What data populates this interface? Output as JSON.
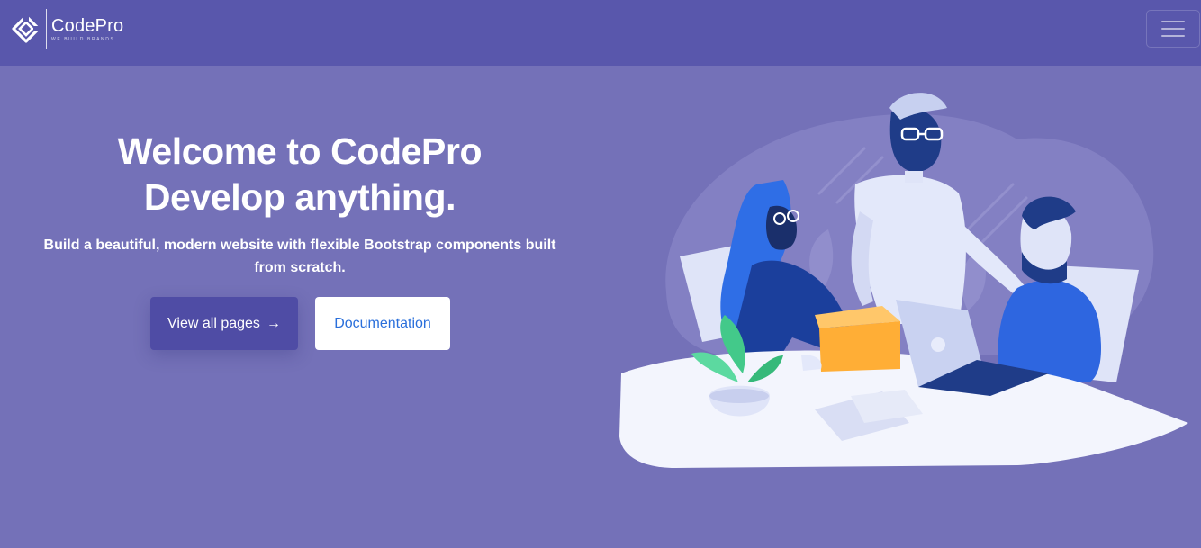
{
  "brand": {
    "name": "CodePro",
    "tagline": "WE BUILD BRANDS",
    "logo_icon": "diamond-logo-icon"
  },
  "navbar": {
    "toggler_icon": "hamburger-menu-icon"
  },
  "hero": {
    "title_line1": "Welcome to CodePro",
    "title_line2": "Develop anything.",
    "subtitle_line1": "Build a beautiful, modern website with flexible Bootstrap components built",
    "subtitle_line2": "from scratch.",
    "primary_button": "View all pages",
    "primary_button_icon": "→",
    "secondary_button": "Documentation",
    "illustration": "team-working-illustration"
  },
  "colors": {
    "page_background": "#7471b8",
    "navbar_background": "#5957ac",
    "primary_button": "#4f4ca5",
    "secondary_button_text": "#2a6fdb"
  }
}
